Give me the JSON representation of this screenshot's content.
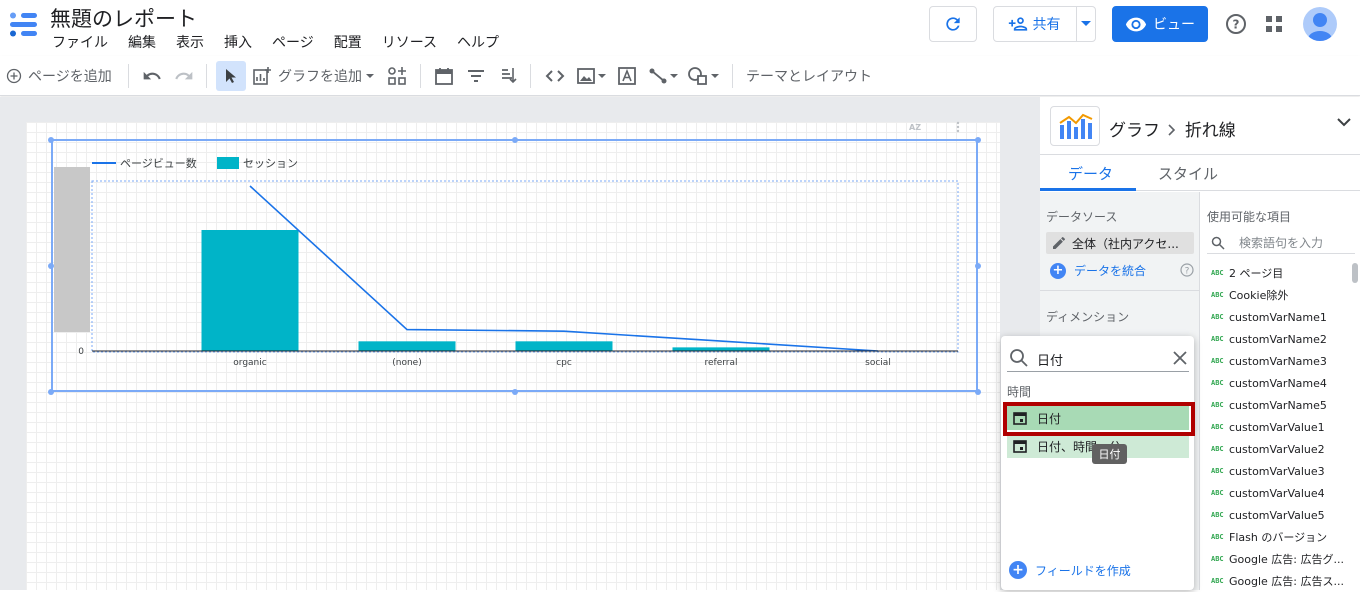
{
  "app": {
    "title": "無題のレポート",
    "menu": [
      "ファイル",
      "編集",
      "表示",
      "挿入",
      "ページ",
      "配置",
      "リソース",
      "ヘルプ"
    ],
    "share_label": "共有",
    "view_label": "ビュー"
  },
  "toolbar": {
    "add_page": "ページを追加",
    "add_chart": "グラフを追加",
    "theme_layout": "テーマとレイアウト"
  },
  "chart_data": {
    "type": "bar",
    "categories": [
      "organic",
      "(none)",
      "cpc",
      "referral",
      "social"
    ],
    "series": [
      {
        "name": "ページビュー数",
        "type": "line",
        "values": [
          100,
          13,
          12,
          6,
          0
        ]
      },
      {
        "name": "セッション",
        "type": "bar",
        "values": [
          100,
          8,
          8,
          3,
          0
        ]
      }
    ],
    "y_tick_label": "0",
    "colors": {
      "line": "#1a73e8",
      "bar": "#00b4c8"
    },
    "legend_position": "top-left"
  },
  "panel": {
    "breadcrumb_root": "グラフ",
    "breadcrumb_leaf": "折れ線",
    "tabs": [
      "データ",
      "スタイル"
    ],
    "datasource_label": "データソース",
    "datasource_value": "全体（社内アクセ...",
    "blend_label": "データを統合",
    "dimension_label": "ディメンション",
    "available_fields_label": "使用可能な項目",
    "search_placeholder": "検索語句を入力",
    "fields": [
      "2 ページ目",
      "Cookie除外",
      "customVarName1",
      "customVarName2",
      "customVarName3",
      "customVarName4",
      "customVarName5",
      "customVarValue1",
      "customVarValue2",
      "customVarValue3",
      "customVarValue4",
      "customVarValue5",
      "Flash のバージョン",
      "Google 広告: 広告グ...",
      "Google 広告: 広告ス..."
    ],
    "field_type_label": "ABC"
  },
  "popup": {
    "query": "日付",
    "category": "時間",
    "items": [
      "日付",
      "日付、時間、分"
    ],
    "tooltip": "日付",
    "create_field": "フィールドを作成"
  }
}
